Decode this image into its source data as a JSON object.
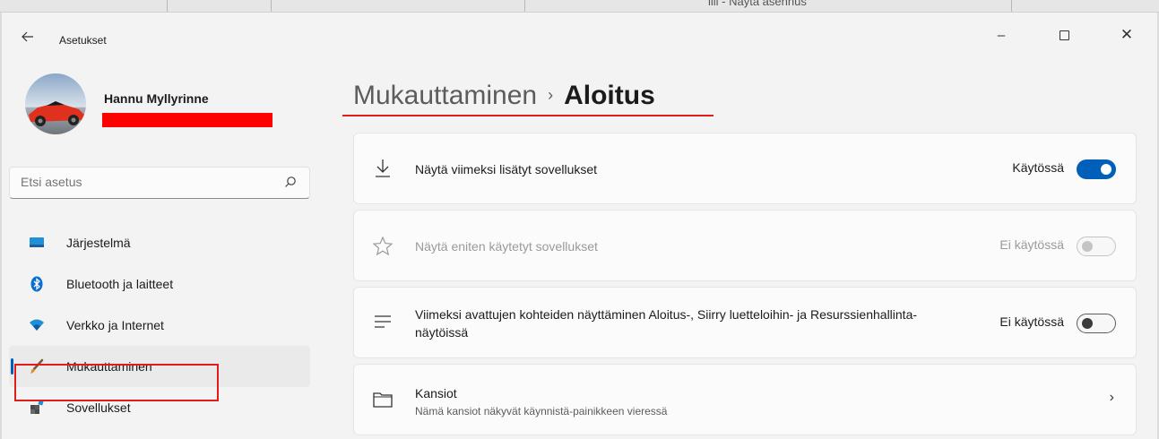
{
  "background": {
    "partial_text": "liii - Näytä asennus"
  },
  "titlebar": {
    "title": "Asetukset",
    "back_icon": "arrow-left-icon",
    "minimize": "–",
    "close": "✕"
  },
  "profile": {
    "name": "Hannu Myllyrinne"
  },
  "search": {
    "placeholder": "Etsi asetus",
    "value": "Etsi asetus"
  },
  "nav": {
    "items": [
      {
        "label": "Järjestelmä",
        "icon": "monitor-icon"
      },
      {
        "label": "Bluetooth ja laitteet",
        "icon": "bluetooth-icon"
      },
      {
        "label": "Verkko ja Internet",
        "icon": "wifi-icon"
      },
      {
        "label": "Mukauttaminen",
        "icon": "brush-icon",
        "active": true
      },
      {
        "label": "Sovellukset",
        "icon": "apps-icon"
      }
    ]
  },
  "breadcrumb": {
    "parent": "Mukauttaminen",
    "separator": "›",
    "current": "Aloitus"
  },
  "settings": [
    {
      "label": "Näytä viimeksi lisätyt sovellukset",
      "state": "Käytössä",
      "toggle": "on"
    },
    {
      "label": "Näytä eniten käytetyt sovellukset",
      "state": "Ei käytössä",
      "toggle": "disabled"
    },
    {
      "label": "Viimeksi avattujen kohteiden näyttäminen Aloitus-, Siirry luetteloihin- ja Resurssienhallinta-näytöissä",
      "state": "Ei käytössä",
      "toggle": "off"
    },
    {
      "label": "Kansiot",
      "sublabel": "Nämä kansiot näkyvät käynnistä-painikkeen vieressä",
      "chevron": "›"
    }
  ],
  "colors": {
    "accent": "#005fb8",
    "annotation": "#e21b1b"
  }
}
